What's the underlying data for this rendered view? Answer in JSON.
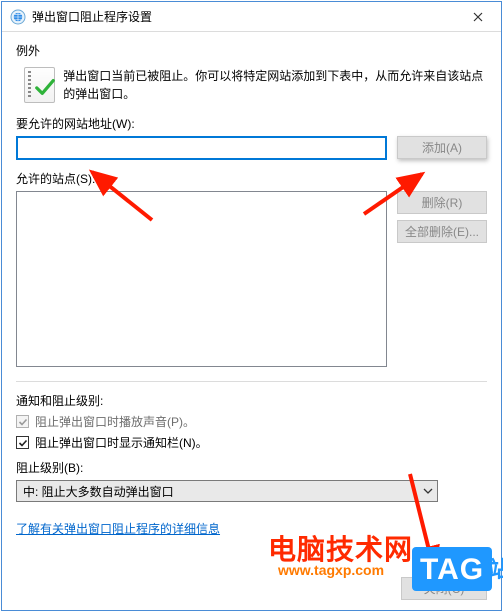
{
  "titlebar": {
    "title": "弹出窗口阻止程序设置"
  },
  "exceptions": {
    "label": "例外",
    "info": "弹出窗口当前已被阻止。你可以将特定网站添加到下表中，从而允许来自该站点的弹出窗口。",
    "address_label": "要允许的网站地址(W):",
    "address_value": "",
    "add_label": "添加(A)",
    "allowed_label": "允许的站点(S):",
    "remove_label": "删除(R)",
    "remove_all_label": "全部删除(E)..."
  },
  "notify": {
    "label": "通知和阻止级别:",
    "cb_sound": "阻止弹出窗口时播放声音(P)。",
    "cb_bar": "阻止弹出窗口时显示通知栏(N)。",
    "level_label": "阻止级别(B):",
    "level_value": "中: 阻止大多数自动弹出窗口"
  },
  "link": {
    "text": "了解有关弹出窗口阻止程序的详细信息"
  },
  "buttons": {
    "close": "关闭(C)"
  },
  "watermark": {
    "site_cn": "电脑技术网",
    "url": "www.tagxp.com",
    "tag": "TAG",
    "partial": "站"
  }
}
